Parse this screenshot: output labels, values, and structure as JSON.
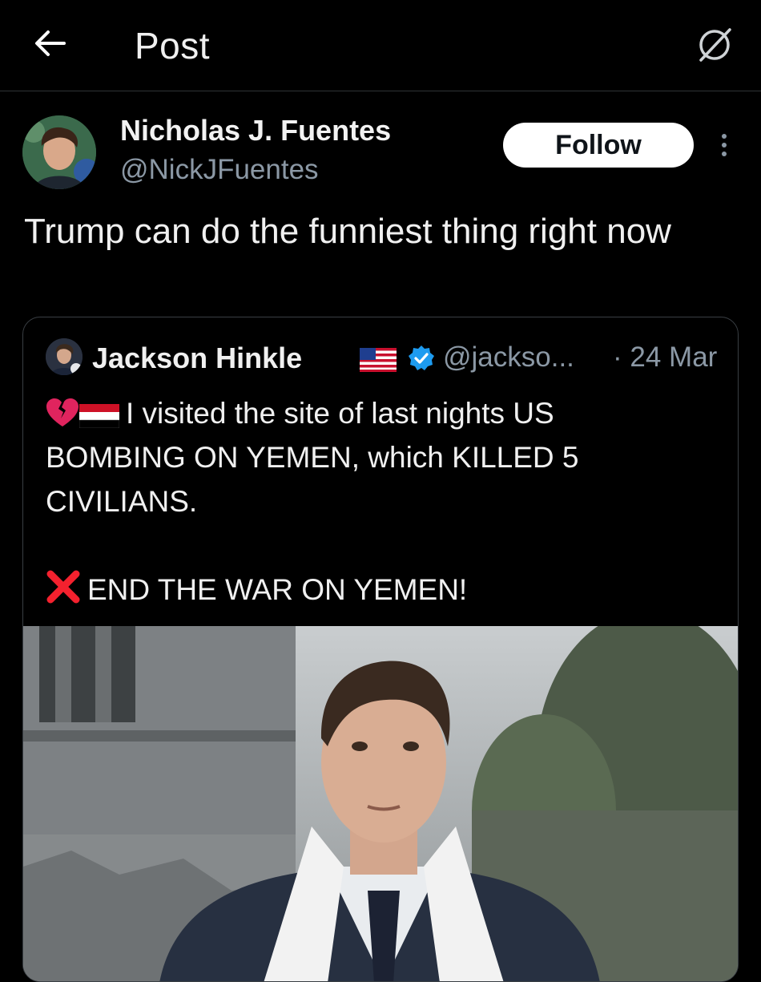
{
  "header": {
    "title": "Post"
  },
  "post": {
    "author_name": "Nicholas J. Fuentes",
    "author_handle": "@NickJFuentes",
    "follow_label": "Follow",
    "text": "Trump can do the funniest thing right now"
  },
  "quote": {
    "author_name": "Jackson Hinkle",
    "author_handle": "@jackso...",
    "date": "· 24 Mar",
    "line1": "I visited the site of last nights US",
    "line2": "BOMBING ON YEMEN, which KILLED 5",
    "line3": "CIVILIANS.",
    "line4": "END THE WAR ON YEMEN!"
  },
  "colors": {
    "background": "#000000",
    "text": "#e7e9ea",
    "muted": "#8b98a5",
    "verified": "#1d9bf0",
    "follow_bg": "#ffffff",
    "divider": "#2f3336"
  },
  "icons": {
    "back": "arrow-left-icon",
    "reader": "reader-mode-icon",
    "more": "more-vertical-icon",
    "verified": "verified-badge-icon",
    "flag_us": "us-flag-icon",
    "flag_yemen": "yemen-flag-icon",
    "broken_heart": "broken-heart-icon",
    "cross_mark": "cross-mark-icon"
  }
}
